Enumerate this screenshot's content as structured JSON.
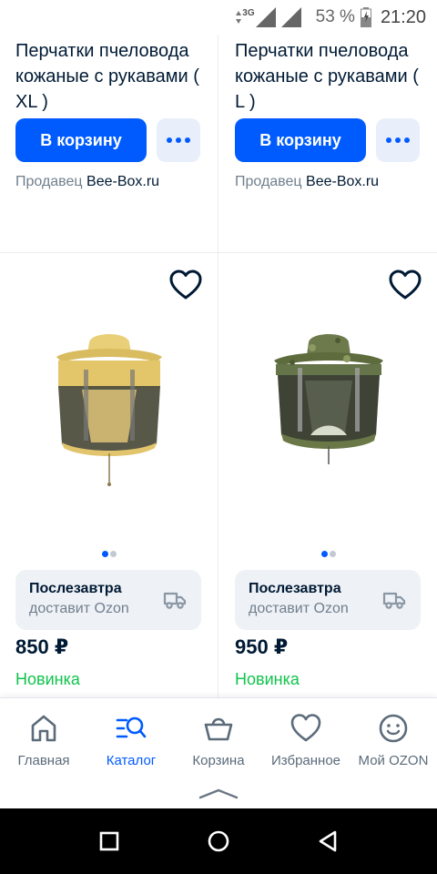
{
  "status_bar": {
    "network": "3G",
    "battery_percent": "53 %",
    "time": "21:20"
  },
  "products_top": [
    {
      "title": "Перчатки пчеловода кожаные с рукавами ( XL )",
      "cart_label": "В корзину",
      "seller_prefix": "Продавец",
      "seller_name": "Bee-Box.ru"
    },
    {
      "title": "Перчатки пчеловода кожаные с рукавами ( L )",
      "cart_label": "В корзину",
      "seller_prefix": "Продавец",
      "seller_name": "Bee-Box.ru"
    }
  ],
  "products_bottom": [
    {
      "image_icon": "beekeeper-hat-yellow",
      "delivery_when": "Послезавтра",
      "delivery_by": "доставит Ozon",
      "price": "850 ₽",
      "badge": "Новинка",
      "image_count": 2,
      "current_image": 1
    },
    {
      "image_icon": "beekeeper-hat-camo",
      "delivery_when": "Послезавтра",
      "delivery_by": "доставит Ozon",
      "price": "950 ₽",
      "badge": "Новинка",
      "image_count": 2,
      "current_image": 1
    }
  ],
  "bottom_nav": {
    "items": [
      {
        "label": "Главная",
        "icon": "home-icon"
      },
      {
        "label": "Каталог",
        "icon": "catalog-search-icon",
        "active": true
      },
      {
        "label": "Корзина",
        "icon": "basket-icon"
      },
      {
        "label": "Избранное",
        "icon": "heart-icon"
      },
      {
        "label": "Мой OZON",
        "icon": "smiley-icon"
      }
    ]
  },
  "colors": {
    "primary": "#005bff",
    "new_badge": "#10c44c",
    "muted_text": "#707f8d",
    "delivery_bg": "#eef1f5"
  }
}
